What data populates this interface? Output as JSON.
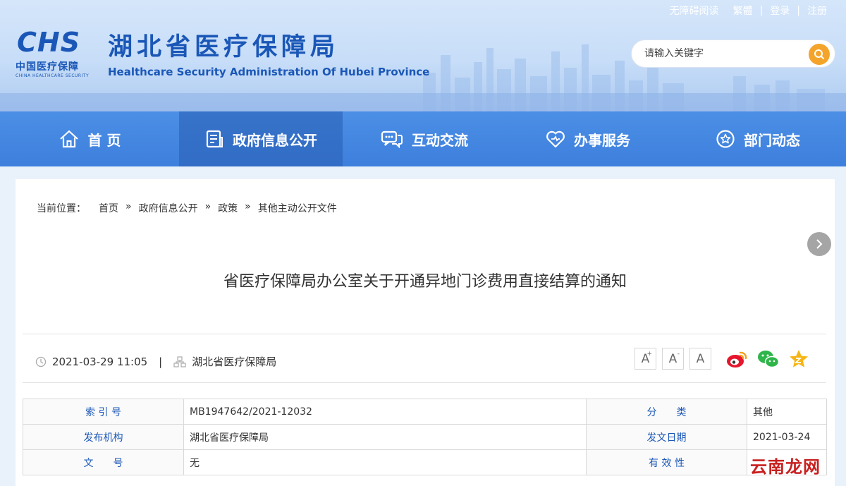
{
  "toplinks": {
    "accessible": "无障碍阅读",
    "traditional": "繁體",
    "login": "登录",
    "register": "注册"
  },
  "logo": {
    "mark": "CHS",
    "cn": "中国医疗保障",
    "en": "CHINA HEALTHCARE SECURITY"
  },
  "site": {
    "title": "湖北省医疗保障局",
    "subtitle": "Healthcare Security Administration Of Hubei Province"
  },
  "search": {
    "placeholder": "请输入关键字"
  },
  "nav": {
    "items": [
      {
        "label": "首 页",
        "icon": "home-icon"
      },
      {
        "label": "政府信息公开",
        "icon": "document-icon",
        "active": true
      },
      {
        "label": "互动交流",
        "icon": "chat-icon"
      },
      {
        "label": "办事服务",
        "icon": "heart-icon"
      },
      {
        "label": "部门动态",
        "icon": "star-icon"
      }
    ]
  },
  "breadcrumb": {
    "label": "当前位置：",
    "items": [
      "首页",
      "政府信息公开",
      "政策",
      "其他主动公开文件"
    ],
    "separator": "»"
  },
  "document": {
    "title": "省医疗保障局办公室关于开通异地门诊费用直接结算的通知",
    "datetime": "2021-03-29 11:05",
    "source": "湖北省医疗保障局",
    "font_sizes": [
      "A",
      "A",
      "A"
    ]
  },
  "info": {
    "rows": [
      {
        "k1": "索 引 号",
        "v1": "MB1947642/2021-12032",
        "k2": "分　　类",
        "v2": "其他"
      },
      {
        "k1": "发布机构",
        "v1": "湖北省医疗保障局",
        "k2": "发文日期",
        "v2": "2021-03-24"
      },
      {
        "k1": "文　　号",
        "v1": "无",
        "k2": "有 效 性",
        "v2": ""
      }
    ]
  },
  "watermark": "云南龙网",
  "colors": {
    "brand": "#1a57b7",
    "nav": "#3d7fdc",
    "search_button": "#f4a42a"
  }
}
